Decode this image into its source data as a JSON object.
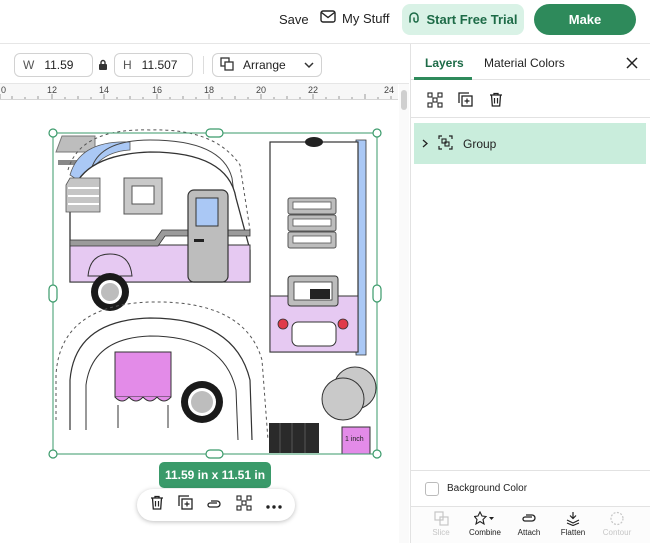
{
  "header": {
    "save_label": "Save",
    "mystuff_label": "My Stuff",
    "trial_label": "Start Free Trial",
    "make_label": "Make"
  },
  "toolbar": {
    "width_label": "W",
    "width_value": "11.59",
    "height_label": "H",
    "height_value": "11.507",
    "arrange_label": "Arrange"
  },
  "ruler": {
    "labels": [
      "0",
      "12",
      "14",
      "16",
      "18",
      "20",
      "22",
      "24"
    ]
  },
  "canvas": {
    "size_badge": "11.59  in x 11.51  in",
    "inch_label": "1 inch"
  },
  "panel": {
    "tabs": [
      "Layers",
      "Material Colors"
    ],
    "active_tab": "Layers",
    "layers": [
      {
        "name": "Group",
        "expanded": false,
        "selected": true
      }
    ],
    "background_color_label": "Background Color",
    "bottom_tools": [
      {
        "label": "Slice",
        "enabled": false
      },
      {
        "label": "Combine",
        "enabled": true
      },
      {
        "label": "Attach",
        "enabled": true
      },
      {
        "label": "Flatten",
        "enabled": true
      },
      {
        "label": "Contour",
        "enabled": false
      }
    ]
  },
  "colors": {
    "brand_green": "#2e8a5b",
    "selected_layer": "#c9eddc",
    "camper_lilac": "#e6c9f2",
    "camper_pink": "#e38be8",
    "window_blue": "#aac8f5"
  },
  "icons": [
    "envelope-icon",
    "curl-icon",
    "lock-icon",
    "arrange-icon",
    "chevron-down-icon",
    "close-icon",
    "ungroup-icon",
    "duplicate-icon",
    "trash-icon",
    "group-icon",
    "chevron-right-icon",
    "attach-icon",
    "more-icon",
    "slice-icon",
    "combine-icon",
    "flatten-icon",
    "contour-icon"
  ]
}
